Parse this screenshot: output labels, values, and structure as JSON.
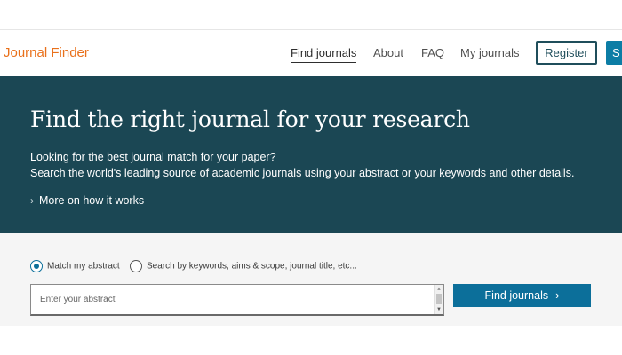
{
  "header": {
    "logo": "Journal Finder",
    "nav": [
      "Find journals",
      "About",
      "FAQ",
      "My journals"
    ],
    "register_label": "Register",
    "signin_label": "S"
  },
  "hero": {
    "title": "Find the right journal for your research",
    "subtitle_line1": "Looking for the best journal match for your paper?",
    "subtitle_line2": "Search the world's leading source of academic journals using your abstract or your keywords and other details.",
    "more_link": "More on how it works"
  },
  "search": {
    "option_abstract": "Match my abstract",
    "option_keywords": "Search by keywords, aims & scope, journal title, etc...",
    "abstract_placeholder": "Enter your abstract",
    "find_button": "Find journals"
  },
  "colors": {
    "brand": "#e9711c",
    "hero_bg": "#1b4754",
    "primary": "#0c6f9a"
  }
}
